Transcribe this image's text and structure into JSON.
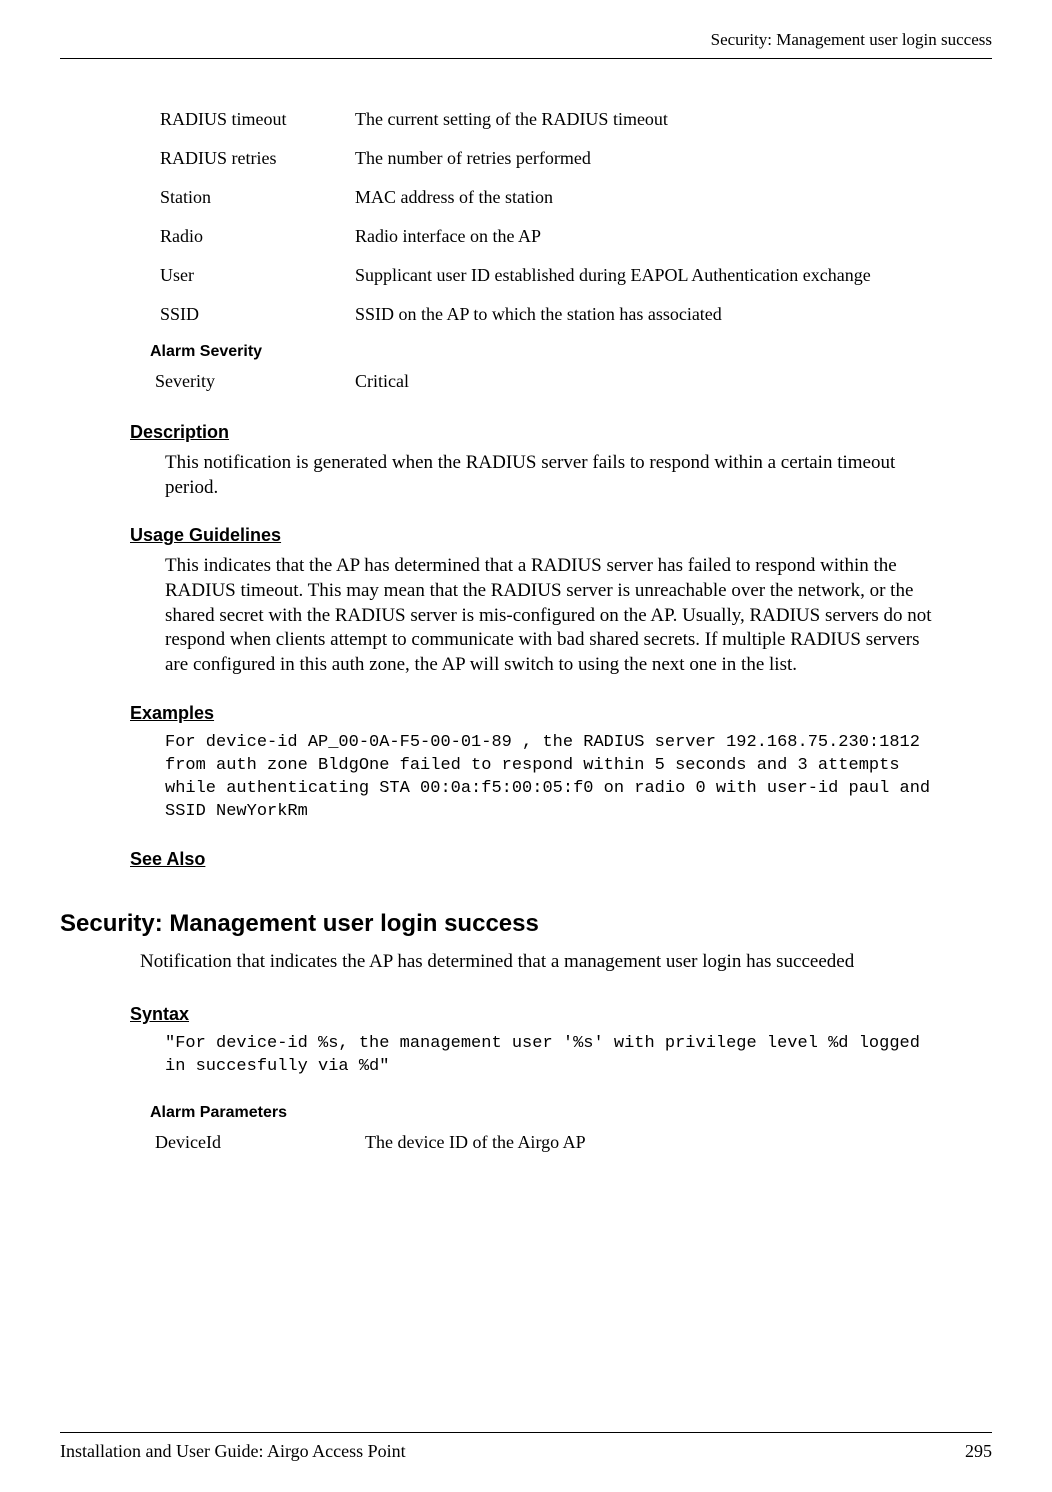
{
  "header": {
    "right": "Security: Management user login success"
  },
  "params_top": [
    {
      "name": "RADIUS timeout",
      "desc": "The current setting of the RADIUS timeout"
    },
    {
      "name": "RADIUS retries",
      "desc": "The number of retries performed"
    },
    {
      "name": "Station",
      "desc": "MAC address of the station"
    },
    {
      "name": "Radio",
      "desc": "Radio interface on the AP"
    },
    {
      "name": "User",
      "desc": "Supplicant user ID established during EAPOL Authentication exchange"
    },
    {
      "name": "SSID",
      "desc": "SSID on the AP to which the station has associated"
    }
  ],
  "alarm_severity": {
    "label": "Alarm Severity",
    "name": "Severity",
    "value": "Critical"
  },
  "description": {
    "heading": "Description",
    "text": "This notification is generated when the RADIUS server fails to respond within a certain timeout period."
  },
  "usage": {
    "heading": "Usage Guidelines",
    "text": "This indicates that the AP has determined that a RADIUS server has failed to respond within the RADIUS timeout. This may mean that the RADIUS server is unreachable over the network, or the shared secret with the RADIUS server is mis-configured on the AP. Usually, RADIUS servers do not respond when clients attempt to communicate with bad shared secrets. If multiple RADIUS servers are configured in this auth zone, the AP will switch to using the next one in the list."
  },
  "examples": {
    "heading": "Examples",
    "text": "For device-id AP_00-0A-F5-00-01-89 , the RADIUS server 192.168.75.230:1812 from auth zone BldgOne failed to respond within 5 seconds and 3 attempts while authenticating STA 00:0a:f5:00:05:f0 on radio 0 with user-id paul and SSID NewYorkRm"
  },
  "see_also": {
    "heading": "See Also"
  },
  "section2": {
    "heading": "Security: Management user login success",
    "intro": "Notification that indicates the AP has determined that a management user login has succeeded"
  },
  "syntax": {
    "heading": "Syntax",
    "text": "\"For device-id %s, the management user '%s' with privilege level %d logged in succesfully via %d\""
  },
  "alarm_params": {
    "label": "Alarm Parameters",
    "rows": [
      {
        "name": "DeviceId",
        "desc": "The device ID of the Airgo AP"
      }
    ]
  },
  "footer": {
    "left": "Installation and User Guide: Airgo Access Point",
    "right": "295"
  }
}
